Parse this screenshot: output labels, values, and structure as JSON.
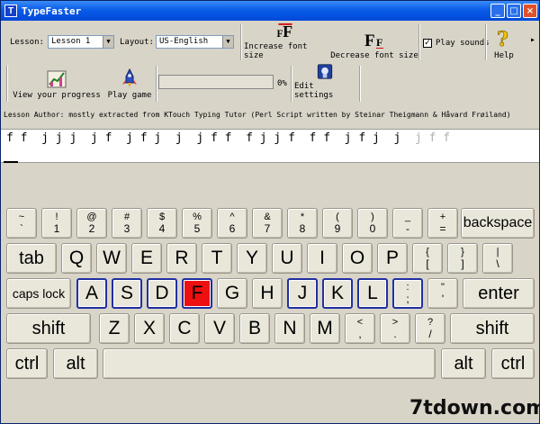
{
  "window": {
    "title": "TypeFaster",
    "icon_letter": "T"
  },
  "controls": {
    "minimize": "_",
    "maximize": "□",
    "close": "×"
  },
  "toolbar": {
    "lesson_label": "Lesson:",
    "lesson_value": "Lesson 1",
    "layout_label": "Layout:",
    "layout_value": "US-English",
    "increase_font_label": "Increase font size",
    "decrease_font_label": "Decrease font size",
    "play_sounds_label": "Play sounds",
    "play_sounds_checked": true,
    "help_label": "Help",
    "view_progress_label": "View your progress",
    "play_game_label": "Play game",
    "progress_percent": 0,
    "progress_text": "0%",
    "edit_settings_label": "Edit settings"
  },
  "lesson_author": "Lesson Author: mostly extracted from KTouch Typing Tutor (Perl Script written by Steinar Theigmann & Håvard Frøiland)",
  "typing": {
    "typed": "f f  j j j  j f  j f j  j  j f f  f j j f  f f  j f j  j  ",
    "remaining": "j f f"
  },
  "keyboard": {
    "row1": [
      {
        "top": "~",
        "bottom": "`"
      },
      {
        "top": "!",
        "bottom": "1"
      },
      {
        "top": "@",
        "bottom": "2"
      },
      {
        "top": "#",
        "bottom": "3"
      },
      {
        "top": "$",
        "bottom": "4"
      },
      {
        "top": "%",
        "bottom": "5"
      },
      {
        "top": "^",
        "bottom": "6"
      },
      {
        "top": "&",
        "bottom": "7"
      },
      {
        "top": "*",
        "bottom": "8"
      },
      {
        "top": "(",
        "bottom": "9"
      },
      {
        "top": ")",
        "bottom": "0"
      },
      {
        "top": "_",
        "bottom": "-"
      },
      {
        "top": "+",
        "bottom": "="
      }
    ],
    "backspace": "backspace",
    "tab": "tab",
    "row2": [
      "Q",
      "W",
      "E",
      "R",
      "T",
      "Y",
      "U",
      "I",
      "O",
      "P"
    ],
    "row2_sym": [
      {
        "top": "{",
        "bottom": "["
      },
      {
        "top": "}",
        "bottom": "]"
      },
      {
        "top": "|",
        "bottom": "\\"
      }
    ],
    "caps_lock": "caps lock",
    "row3": [
      "A",
      "S",
      "D",
      "F",
      "G",
      "H",
      "J",
      "K",
      "L"
    ],
    "row3_sym": [
      {
        "top": ":",
        "bottom": ";"
      },
      {
        "top": "\"",
        "bottom": "'"
      }
    ],
    "enter": "enter",
    "shift_left": "shift",
    "row4": [
      "Z",
      "X",
      "C",
      "V",
      "B",
      "N",
      "M"
    ],
    "row4_sym": [
      {
        "top": "<",
        "bottom": ","
      },
      {
        "top": ">",
        "bottom": "."
      },
      {
        "top": "?",
        "bottom": "/"
      }
    ],
    "shift_right": "shift",
    "ctrl_left": "ctrl",
    "alt_left": "alt",
    "space": "",
    "alt_right": "alt",
    "ctrl_right": "ctrl",
    "home_keys": [
      "A",
      "S",
      "D",
      "F",
      "J",
      "K",
      "L",
      ";"
    ],
    "active_key": "F"
  },
  "colors": {
    "active_key": "#ee1010",
    "home_key_border": "#2030a0",
    "title_bar": "#0a5ce8"
  },
  "watermark": "7tdown.com"
}
